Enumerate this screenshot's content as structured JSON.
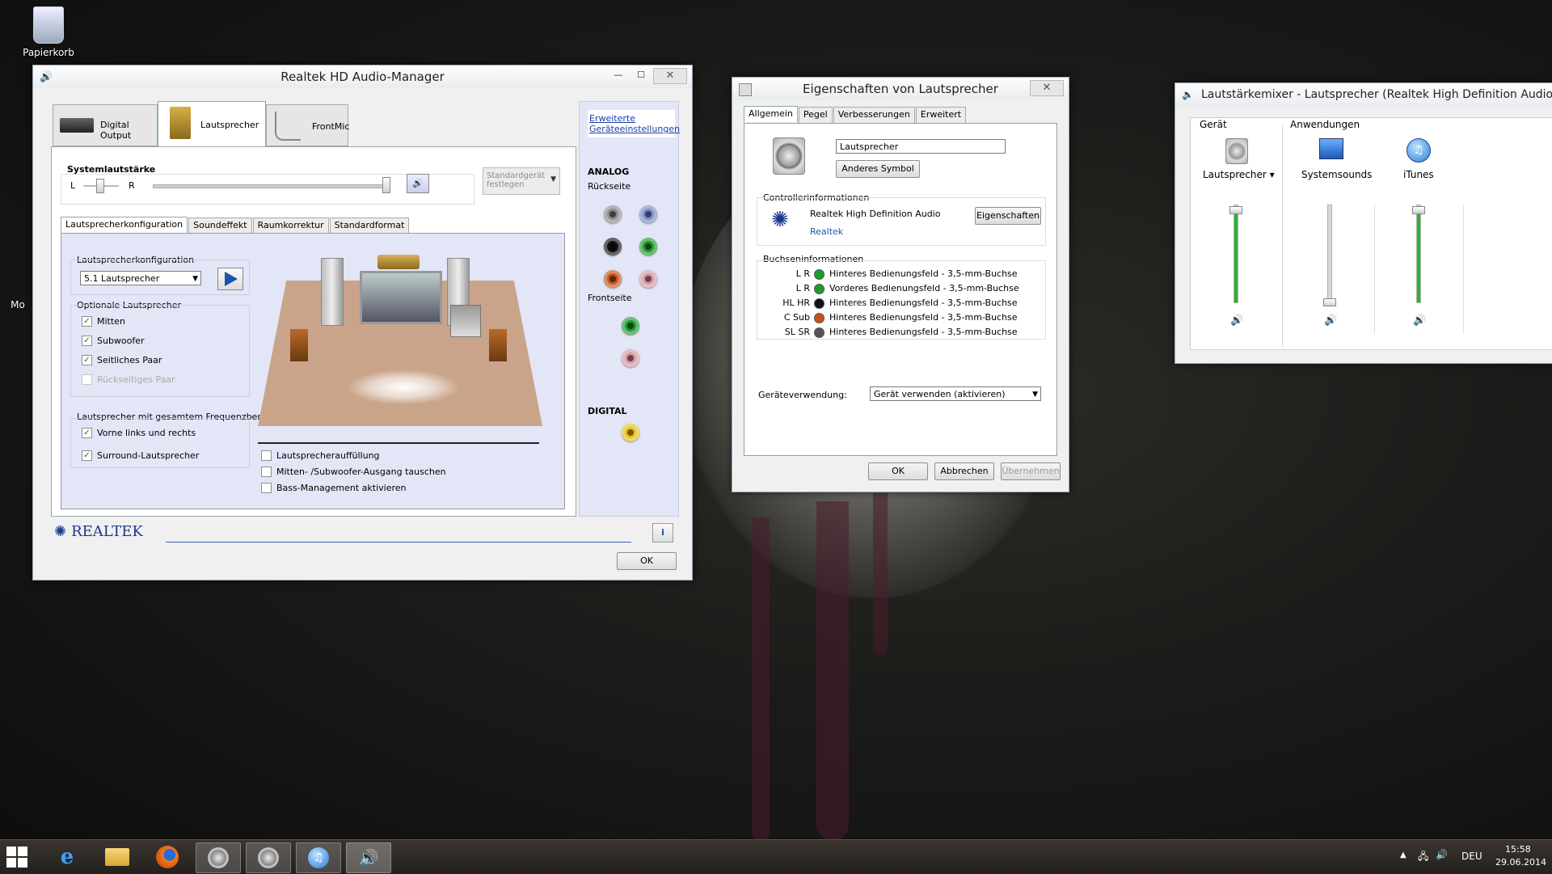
{
  "desktop": {
    "icons": [
      {
        "label": "Papierkorb"
      },
      {
        "label": "Mo"
      }
    ]
  },
  "realtek": {
    "title": "Realtek HD Audio-Manager",
    "device_tabs": [
      {
        "label": "Digital Output"
      },
      {
        "label": "Lautsprecher"
      },
      {
        "label": "FrontMic"
      }
    ],
    "advanced_link_line1": "Erweiterte",
    "advanced_link_line2": "Geräteeinstellungen",
    "system_volume_label": "Systemlautstärke",
    "balance_left": "L",
    "balance_right": "R",
    "default_device_line1": "Standardgerät",
    "default_device_line2": "festlegen",
    "analog_label": "ANALOG",
    "rear_label": "Rückseite",
    "front_label": "Frontseite",
    "digital_label": "DIGITAL",
    "sub_tabs": [
      {
        "label": "Lautsprecherkonfiguration"
      },
      {
        "label": "Soundeffekt"
      },
      {
        "label": "Raumkorrektur"
      },
      {
        "label": "Standardformat"
      }
    ],
    "config_group_label": "Lautsprecherkonfiguration",
    "config_value": "5.1 Lautsprecher",
    "optional_group_label": "Optionale Lautsprecher",
    "optional_speakers": [
      {
        "label": "Mitten",
        "checked": "✓"
      },
      {
        "label": "Subwoofer",
        "checked": "✓"
      },
      {
        "label": "Seitliches Paar",
        "checked": "✓"
      },
      {
        "label": "Rückseitiges Paar",
        "checked": ""
      }
    ],
    "fullrange_group_label": "Lautsprecher mit gesamtem Frequenzbereich",
    "fullrange_speakers": [
      {
        "label": "Vorne links und rechts",
        "checked": "✓"
      },
      {
        "label": "Surround-Lautsprecher",
        "checked": "✓"
      }
    ],
    "options": [
      {
        "label": "Lautsprecherauffüllung"
      },
      {
        "label": "Mitten- /Subwoofer-Ausgang tauschen"
      },
      {
        "label": "Bass-Management aktivieren"
      }
    ],
    "brand": "REALTEK",
    "ok_label": "OK",
    "info_label": "i",
    "jack_colors": {
      "rear": [
        "#8c8c8c",
        "#7a8fc8",
        "#111111",
        "#1f9a2e",
        "#c4541a",
        "#d99aa6"
      ],
      "front": [
        "#1f9a2e",
        "#d99aa6"
      ],
      "digital": "#e8c21a"
    }
  },
  "props": {
    "title": "Eigenschaften von Lautsprecher",
    "tabs": [
      {
        "label": "Allgemein"
      },
      {
        "label": "Pegel"
      },
      {
        "label": "Verbesserungen"
      },
      {
        "label": "Erweitert"
      }
    ],
    "name_value": "Lautsprecher",
    "change_icon_label": "Anderes Symbol",
    "controller_group_label": "Controllerinformationen",
    "controller_name": "Realtek High Definition Audio",
    "controller_vendor": "Realtek",
    "properties_button": "Eigenschaften",
    "jack_group_label": "Buchseninformationen",
    "jacks": [
      {
        "code": "L R",
        "color": "#1f9a2e",
        "desc": "Hinteres Bedienungsfeld - 3,5-mm-Buchse"
      },
      {
        "code": "L R",
        "color": "#1f9a2e",
        "desc": "Vorderes Bedienungsfeld - 3,5-mm-Buchse"
      },
      {
        "code": "HL HR",
        "color": "#111111",
        "desc": "Hinteres Bedienungsfeld - 3,5-mm-Buchse"
      },
      {
        "code": "C Sub",
        "color": "#c4541a",
        "desc": "Hinteres Bedienungsfeld - 3,5-mm-Buchse"
      },
      {
        "code": "SL SR",
        "color": "#555555",
        "desc": "Hinteres Bedienungsfeld - 3,5-mm-Buchse"
      }
    ],
    "usage_label": "Geräteverwendung:",
    "usage_value": "Gerät verwenden (aktivieren)",
    "ok_label": "OK",
    "cancel_label": "Abbrechen",
    "apply_label": "Übernehmen"
  },
  "mixer": {
    "title": "Lautstärkemixer - Lautsprecher (Realtek High Definition Audio)",
    "device_header": "Gerät",
    "apps_header": "Anwendungen",
    "channels": [
      {
        "name": "Lautsprecher ▾",
        "level": 0.95
      },
      {
        "name": "Systemsounds",
        "level": 0.0
      },
      {
        "name": "iTunes",
        "level": 0.95
      }
    ]
  },
  "taskbar": {
    "language": "DEU",
    "time": "15:58",
    "date": "29.06.2014"
  }
}
